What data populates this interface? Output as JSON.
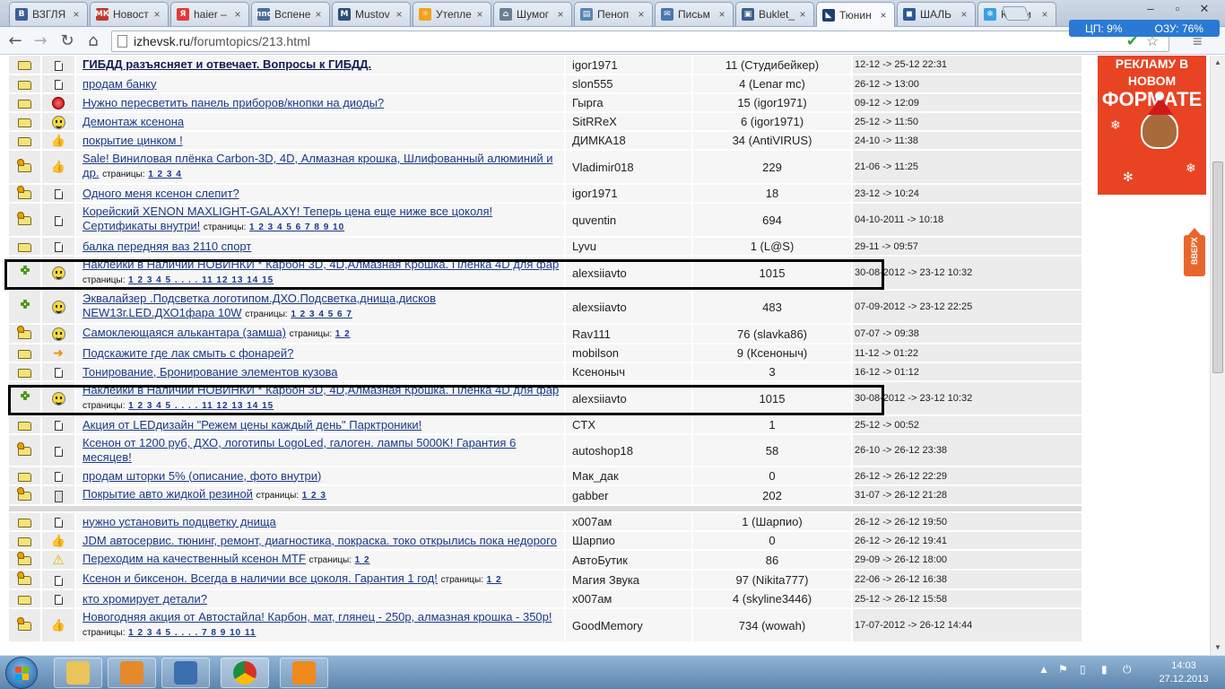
{
  "browser": {
    "tabs": [
      {
        "title": "ВЗГЛЯ",
        "icon": "blog-icon",
        "color": "#3a5e97",
        "glyph": "B"
      },
      {
        "title": "Новост",
        "icon": "news-icon",
        "color": "#c0392b",
        "glyph": "МК"
      },
      {
        "title": "haier –",
        "icon": "yandex-icon",
        "color": "#e53935",
        "glyph": "Я"
      },
      {
        "title": "Вспене",
        "icon": "pps-icon",
        "color": "#4a6e9a",
        "glyph": "ппс"
      },
      {
        "title": "Mustov",
        "icon": "site-icon",
        "color": "#2e4f79",
        "glyph": "M"
      },
      {
        "title": "Утепле",
        "icon": "sun-icon",
        "color": "#f4a21c",
        "glyph": "☼"
      },
      {
        "title": "Шумог",
        "icon": "house-icon",
        "color": "#6b7e94",
        "glyph": "⌂"
      },
      {
        "title": "Пеноп",
        "icon": "doc-icon",
        "color": "#5b85b3",
        "glyph": "▤"
      },
      {
        "title": "Письм",
        "icon": "mail-icon",
        "color": "#4a77b0",
        "glyph": "✉"
      },
      {
        "title": "Buklet_",
        "icon": "pdf-icon",
        "color": "#3c5f8d",
        "glyph": "▣"
      },
      {
        "title": "Тюнин",
        "icon": "forum-icon",
        "color": "#1d3f6e",
        "glyph": "◣"
      },
      {
        "title": "ШАЛЬ",
        "icon": "site-icon",
        "color": "#2b5a95",
        "glyph": "◼"
      },
      {
        "title": "Конди",
        "icon": "snowflake-icon",
        "color": "#3aa0e0",
        "glyph": "❄"
      }
    ],
    "active_tab": 10,
    "url_host": "izhevsk.ru",
    "url_path": "/forumtopics/213.html",
    "usage": {
      "cpu": "ЦП: 9%",
      "ram": "ОЗУ: 76%"
    }
  },
  "topics": [
    {
      "icon1": "folder",
      "icon2": "doc",
      "title": "ГИБДД разъясняет и отвечает. Вопросы к ГИБДД.",
      "bold": true,
      "pages_label": "",
      "pages": "",
      "author": "igor1971",
      "replies": "11 (Студибейкер)",
      "date": "12-12 -> 25-12 22:31"
    },
    {
      "icon1": "folder",
      "icon2": "doc",
      "title": "продам банку",
      "pages_label": "",
      "pages": "",
      "author": "slon555",
      "replies": "4 (Lenar mc)",
      "date": "26-12 -> 13:00"
    },
    {
      "icon1": "folder",
      "icon2": "redball",
      "title": "Нужно пересветить панель приборов/кнопки на диоды?",
      "pages_label": "",
      "pages": "",
      "author": "Гырга",
      "replies": "15 (igor1971)",
      "date": "09-12 -> 12:09"
    },
    {
      "icon1": "folder",
      "icon2": "smile",
      "title": "Демонтаж ксенона",
      "pages_label": "",
      "pages": "",
      "author": "SitRReX",
      "replies": "6 (igor1971)",
      "date": "25-12 -> 11:50"
    },
    {
      "icon1": "folder",
      "icon2": "thumb",
      "title": "покрытие цинком !",
      "pages_label": "",
      "pages": "",
      "author": "ДИМКА18",
      "replies": "34 (AntiVIRUS)",
      "date": "24-10 -> 11:38"
    },
    {
      "icon1": "folder-hot",
      "icon2": "thumb",
      "title": "Sale! Виниловая плёнка Carbon-3D, 4D, Алмазная крошка, Шлифованный алюминий и др.",
      "pages_label": "страницы:",
      "pages": "1 2 3 4",
      "author": "Vladimir018",
      "replies": "229",
      "date": "21-06 -> 11:25"
    },
    {
      "icon1": "folder-hot",
      "icon2": "doc",
      "title": "Одного меня ксенон слепит?",
      "pages_label": "",
      "pages": "",
      "author": "igor1971",
      "replies": "18",
      "date": "23-12 -> 10:24"
    },
    {
      "icon1": "folder-hot",
      "icon2": "doc",
      "title": "Корейский XENON MAXLIGHT-GALAXY! Теперь цена еще ниже все цоколя! Сертификаты внутри!",
      "pages_label": "страницы:",
      "pages": "1 2 3 4 5 6 7 8 9 10",
      "author": "quventin",
      "replies": "694",
      "date": "04-10-2011 -> 10:18"
    },
    {
      "icon1": "folder",
      "icon2": "doc",
      "title": "балка передняя ваз 2110 спорт",
      "pages_label": "",
      "pages": "",
      "author": "Lyvu",
      "replies": "1 (L@S)",
      "date": "29-11 -> 09:57"
    },
    {
      "icon1": "star",
      "icon2": "smile",
      "title": "Наклейки в Наличии НОВИНКИ * Карбон 3D, 4D,Алмазная Крошка. Плёнка 4D для фар",
      "pages_label": "страницы:",
      "pages": "1 2 3 4 5 . . . . 11 12 13 14 15",
      "author": "alexsiiavto",
      "replies": "1015",
      "date": "30-08-2012 -> 23-12 10:32"
    },
    {
      "icon1": "star",
      "icon2": "smile",
      "title": "Эквалайзер .Подсветка логотипом.ДХО.Подсветка,днища,дисков NEW13г.LED.ДХО1фара 10W",
      "pages_label": "страницы:",
      "pages": "1 2 3 4 5 6 7",
      "author": "alexsiiavto",
      "replies": "483",
      "date": "07-09-2012 -> 23-12 22:25"
    },
    {
      "icon1": "folder-hot",
      "icon2": "smile",
      "title": "Самоклеющаяся алькантара (замша)",
      "pages_label": "страницы:",
      "pages": "1 2",
      "author": "Rav111",
      "replies": "76 (slavka86)",
      "date": "07-07 -> 09:38"
    },
    {
      "icon1": "folder",
      "icon2": "arrow",
      "title": "Подскажите где лак смыть с фонарей?",
      "pages_label": "",
      "pages": "",
      "author": "mobilson",
      "replies": "9 (Ксеноныч)",
      "date": "11-12 -> 01:22"
    },
    {
      "icon1": "folder",
      "icon2": "doc",
      "title": "Тонирование, Бронирование элементов кузова",
      "pages_label": "",
      "pages": "",
      "author": "Ксеноныч",
      "replies": "3",
      "date": "16-12 -> 01:12"
    },
    {
      "icon1": "star",
      "icon2": "smile",
      "title": "Наклейки в Наличии НОВИНКИ * Карбон 3D, 4D,Алмазная Крошка. Плёнка 4D для фар",
      "pages_label": "страницы:",
      "pages": "1 2 3 4 5 . . . . 11 12 13 14 15",
      "author": "alexsiiavto",
      "replies": "1015",
      "date": "30-08-2012 -> 23-12 10:32"
    },
    {
      "icon1": "folder",
      "icon2": "doc",
      "title": "Акция от LEDдизайн \"Режем цены каждый день\" Парктроники!",
      "pages_label": "",
      "pages": "",
      "author": "CTX",
      "replies": "1",
      "date": "25-12 -> 00:52"
    },
    {
      "icon1": "folder-hot",
      "icon2": "doc",
      "title": "Ксенон от 1200 руб, ДХО, логотипы LogoLed, галоген. лампы 5000K! Гарантия 6 месяцев!",
      "pages_label": "",
      "pages": "",
      "author": "autoshop18",
      "replies": "58",
      "date": "26-10 -> 26-12 23:38"
    },
    {
      "icon1": "folder",
      "icon2": "doc",
      "title": "продам шторки 5% (описание, фото внутри)",
      "pages_label": "",
      "pages": "",
      "author": "Мак_дак",
      "replies": "0",
      "date": "26-12 -> 26-12 22:29"
    },
    {
      "icon1": "folder-hot",
      "icon2": "phone",
      "title": "Покрытие авто жидкой резиной",
      "pages_label": "страницы:",
      "pages": "1 2 3",
      "author": "gabber",
      "replies": "202",
      "date": "31-07 -> 26-12 21:28"
    },
    {
      "spacer": true
    },
    {
      "icon1": "folder",
      "icon2": "doc",
      "title": "нужно установить подцветку днища",
      "pages_label": "",
      "pages": "",
      "author": "x007ам",
      "replies": "1 (Шарпио)",
      "date": "26-12 -> 26-12 19:50"
    },
    {
      "icon1": "folder-lock",
      "icon2": "thumb",
      "title": "JDM автосервис. тюнинг, ремонт, диагностика, покраска. токо открылись пока недорого",
      "pages_label": "",
      "pages": "",
      "author": "Шарпио",
      "replies": "0",
      "date": "26-12 -> 26-12 19:41"
    },
    {
      "icon1": "folder-hot",
      "icon2": "warn",
      "title": "Переходим на качественный ксенон MTF",
      "pages_label": "страницы:",
      "pages": "1 2",
      "author": "АвтоБутик",
      "replies": "86",
      "date": "29-09 -> 26-12 18:00"
    },
    {
      "icon1": "folder-hot",
      "icon2": "doc",
      "title": "Ксенон и биксенон. Всегда в наличии все цоколя. Гарантия 1 год!",
      "pages_label": "страницы:",
      "pages": "1 2",
      "author": "Магия Звука",
      "replies": "97 (Nikita777)",
      "date": "22-06 -> 26-12 16:38"
    },
    {
      "icon1": "folder",
      "icon2": "doc",
      "title": "кто хромирует детали?",
      "pages_label": "",
      "pages": "",
      "author": "x007ам",
      "replies": "4 (skyline3446)",
      "date": "25-12 -> 26-12 15:58"
    },
    {
      "icon1": "folder-hot",
      "icon2": "thumb",
      "title": "Новогодняя акция от Автостайла! Карбон, мат, глянец - 250р, алмазная крошка - 350р!",
      "pages_label": "страницы:",
      "pages": "1 2 3 4 5 . . . . 7 8 9 10 11",
      "author": "GoodMemory",
      "replies": "734 (wowah)",
      "date": "17-07-2012 -> 26-12 14:44"
    }
  ],
  "ad": {
    "line1": "РЕКЛАМУ В НОВОМ",
    "line2": "ФОРМАТЕ",
    "up_label": "ВВЕРХ"
  },
  "taskbar": {
    "apps": [
      {
        "name": "explorer",
        "icon": "folder-icon",
        "color": "#e8c45a"
      },
      {
        "name": "media",
        "icon": "media-player-icon",
        "color": "#e58a2a"
      },
      {
        "name": "virtualbox",
        "icon": "virtualbox-icon",
        "color": "#3b6fb0"
      },
      {
        "name": "chrome",
        "icon": "chrome-icon",
        "color": "#d93025"
      },
      {
        "name": "kmplayer",
        "icon": "kmplayer-icon",
        "color": "#f08a1c"
      }
    ],
    "time": "14:03",
    "date": "27.12.2013"
  }
}
